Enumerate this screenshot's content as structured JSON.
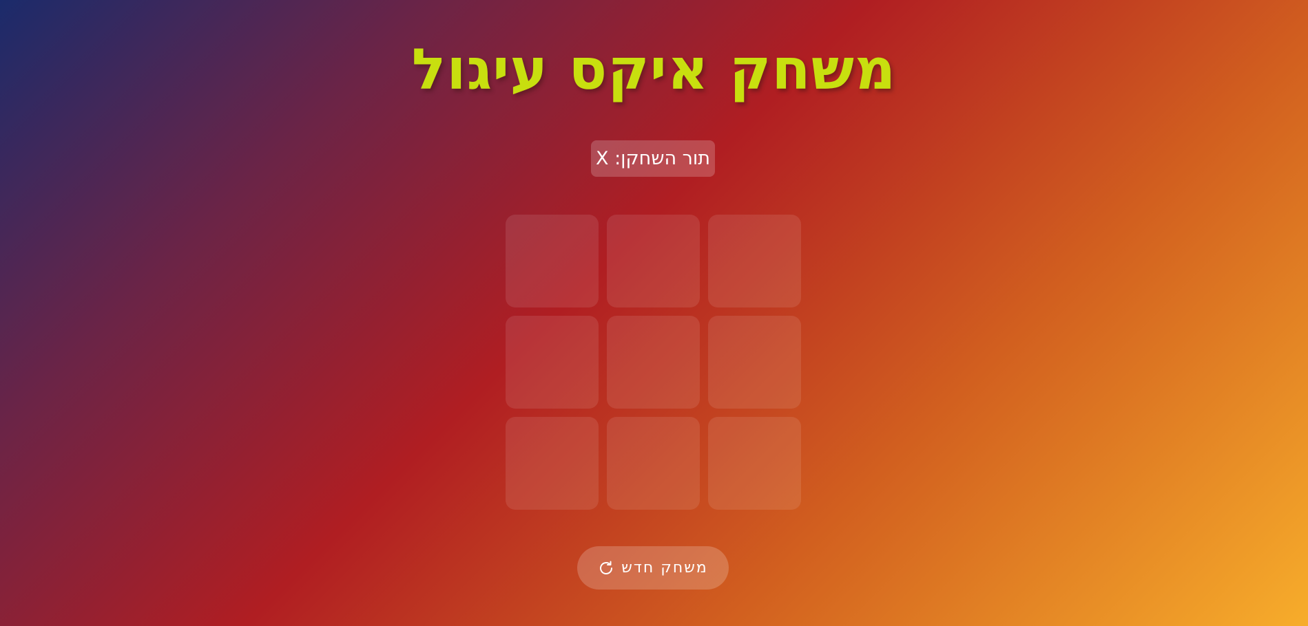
{
  "title": "משחק איקס עיגול",
  "status": {
    "label": "תור השחקן:",
    "player": "X",
    "text": "תור השחקן: X"
  },
  "board": {
    "cells": [
      "",
      "",
      "",
      "",
      "",
      "",
      "",
      "",
      ""
    ]
  },
  "new_game_button": {
    "label": "משחק חדש",
    "icon": "refresh-icon"
  },
  "colors": {
    "title": "#c8df0f",
    "gradient_start": "#1b2b6b",
    "gradient_mid": "#b01e22",
    "gradient_end": "#f7ad2b"
  }
}
